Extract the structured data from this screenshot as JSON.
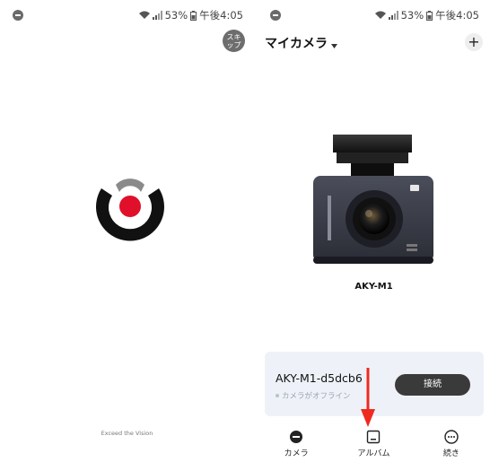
{
  "status": {
    "time": "午後4:05",
    "battery": "53%"
  },
  "splash": {
    "skip_label": "スキップ",
    "tagline": "Exceed the Vision"
  },
  "main": {
    "title": "マイカメラ",
    "add_label": "+",
    "device_model": "AKY-M1",
    "device_card": {
      "name": "AKY-M1-d5dcb6",
      "status": "カメラがオフライン",
      "connect_label": "接続"
    }
  },
  "tabs": [
    {
      "label": "カメラ",
      "icon": "camera-icon"
    },
    {
      "label": "アルバム",
      "icon": "album-icon"
    },
    {
      "label": "続き",
      "icon": "more-icon"
    }
  ],
  "colors": {
    "logo_red": "#e0102a",
    "arrow_red": "#ee2a1f",
    "card_bg": "#eef2f8",
    "button_dark": "#3a3a3a"
  }
}
